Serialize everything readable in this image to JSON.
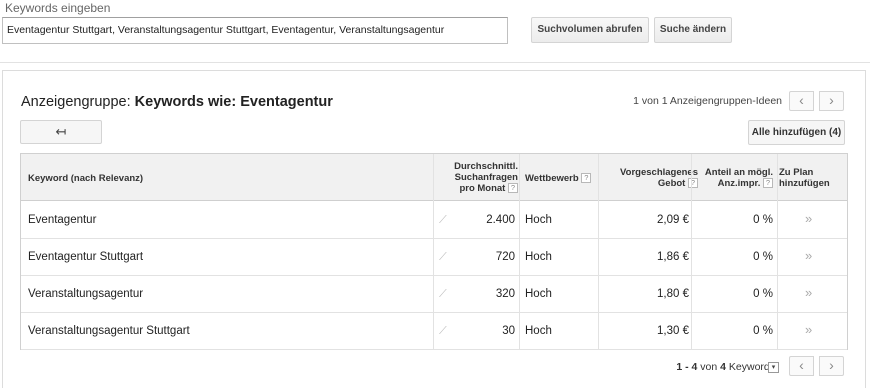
{
  "search": {
    "label": "Keywords eingeben",
    "value": "Eventagentur Stuttgart, Veranstaltungsagentur Stuttgart, Eventagentur, Veranstaltungsagentur",
    "btn_volume": "Suchvolumen abrufen",
    "btn_change": "Suche ändern"
  },
  "group": {
    "title_prefix": "Anzeigengruppe: ",
    "title_name": "Keywords wie: Eventagentur",
    "pager": "1 von 1 Anzeigengruppen-Ideen",
    "back_icon": "↤",
    "add_all": "Alle hinzufügen (4)"
  },
  "table": {
    "headers": {
      "keyword": "Keyword (nach Relevanz)",
      "volume_l1": "Durchschnittl.",
      "volume_l2": "Suchanfragen",
      "volume_l3": "pro Monat",
      "competition": "Wettbewerb",
      "bid_l1": "Vorgeschlagenes",
      "bid_l2": "Gebot",
      "share_l1": "Anteil an mögl.",
      "share_l2": "Anz.impr.",
      "plan_l1": "Zu Plan",
      "plan_l2": "hinzufügen"
    },
    "help_icon": "?",
    "trend_icon": "⟋",
    "add_icon": "»",
    "rows": [
      {
        "keyword": "Eventagentur",
        "volume": "2.400",
        "competition": "Hoch",
        "bid": "2,09 €",
        "share": "0 %"
      },
      {
        "keyword": "Eventagentur Stuttgart",
        "volume": "720",
        "competition": "Hoch",
        "bid": "1,86 €",
        "share": "0 %"
      },
      {
        "keyword": "Veranstaltungsagentur",
        "volume": "320",
        "competition": "Hoch",
        "bid": "1,80 €",
        "share": "0 %"
      },
      {
        "keyword": "Veranstaltungsagentur Stuttgart",
        "volume": "30",
        "competition": "Hoch",
        "bid": "1,30 €",
        "share": "0 %"
      }
    ]
  },
  "footer": {
    "range": "1 - 4",
    "of": "von",
    "count": "4",
    "unit": "Keywords",
    "dropdown_icon": "▾"
  },
  "nav": {
    "prev": "‹",
    "next": "›"
  }
}
